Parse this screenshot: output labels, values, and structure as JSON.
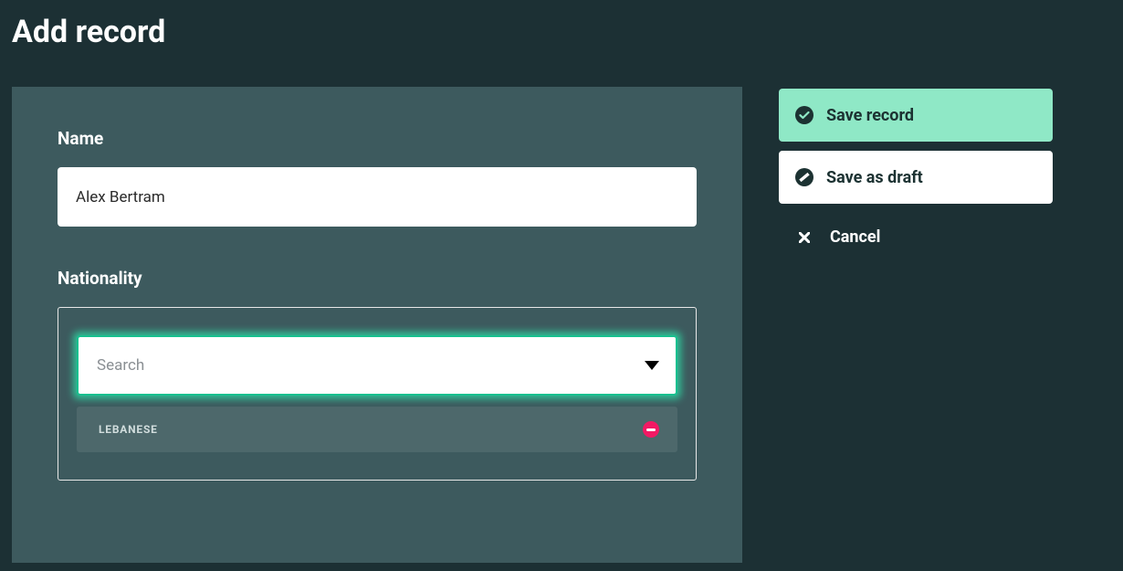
{
  "page": {
    "title": "Add record"
  },
  "form": {
    "name": {
      "label": "Name",
      "value": "Alex Bertram"
    },
    "nationality": {
      "label": "Nationality",
      "search_placeholder": "Search",
      "selected": [
        {
          "label": "LEBANESE"
        }
      ]
    }
  },
  "actions": {
    "save": "Save record",
    "draft": "Save as draft",
    "cancel": "Cancel"
  }
}
